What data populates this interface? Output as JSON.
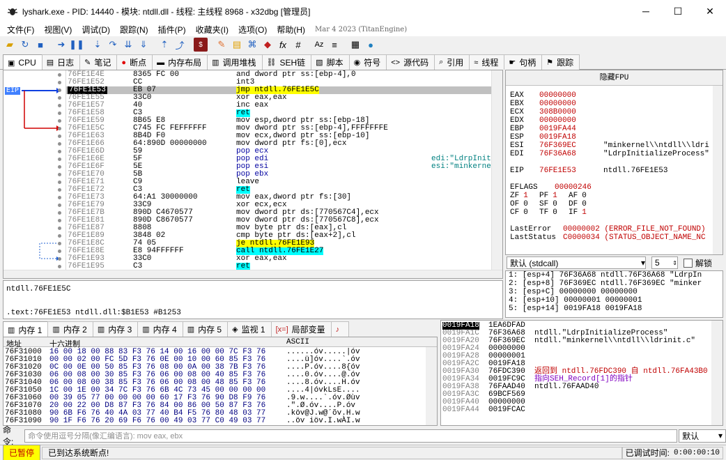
{
  "window": {
    "title": "lyshark.exe - PID: 14440 - 模块: ntdll.dll - 线程: 主线程 8968 - x32dbg [管理员]",
    "app_icon": "bug-icon"
  },
  "menu": {
    "items": [
      "文件(F)",
      "视图(V)",
      "调试(D)",
      "跟踪(N)",
      "插件(P)",
      "收藏夹(I)",
      "选项(O)",
      "帮助(H)"
    ],
    "build_date": "Mar 4 2023 (TitanEngine)"
  },
  "tabs": [
    {
      "label": "CPU",
      "icon": "cpu-icon"
    },
    {
      "label": "日志",
      "icon": "log-icon"
    },
    {
      "label": "笔记",
      "icon": "notes-icon"
    },
    {
      "label": "断点",
      "icon": "breakpoint-icon"
    },
    {
      "label": "内存布局",
      "icon": "memory-map-icon"
    },
    {
      "label": "调用堆栈",
      "icon": "call-stack-icon"
    },
    {
      "label": "SEH链",
      "icon": "seh-icon"
    },
    {
      "label": "脚本",
      "icon": "script-icon"
    },
    {
      "label": "符号",
      "icon": "symbols-icon"
    },
    {
      "label": "源代码",
      "icon": "source-icon"
    },
    {
      "label": "引用",
      "icon": "references-icon"
    },
    {
      "label": "线程",
      "icon": "threads-icon"
    },
    {
      "label": "句柄",
      "icon": "handles-icon"
    },
    {
      "label": "跟踪",
      "icon": "trace-icon"
    }
  ],
  "disasm": {
    "eip_label": "EIP",
    "rows": [
      {
        "addr": "76FE1E4E",
        "bytes": "8365 FC 00",
        "ins": "and dword ptr ss:[ebp-4],0",
        "com": ""
      },
      {
        "addr": "76FE1E52",
        "bytes": "CC",
        "ins": "int3",
        "com": ""
      },
      {
        "addr": "76FE1E53",
        "bytes": "EB 07",
        "ins": "jmp ntdll.76FE1E5C",
        "com": ""
      },
      {
        "addr": "76FE1E55",
        "bytes": "33C0",
        "ins": "xor eax,eax",
        "com": ""
      },
      {
        "addr": "76FE1E57",
        "bytes": "40",
        "ins": "inc eax",
        "com": ""
      },
      {
        "addr": "76FE1E58",
        "bytes": "C3",
        "ins": "ret",
        "com": ""
      },
      {
        "addr": "76FE1E59",
        "bytes": "8B65 E8",
        "ins": "mov esp,dword ptr ss:[ebp-18]",
        "com": ""
      },
      {
        "addr": "76FE1E5C",
        "bytes": "C745 FC FEFFFFFF",
        "ins": "mov dword ptr ss:[ebp-4],FFFFFFFE",
        "com": ""
      },
      {
        "addr": "76FE1E63",
        "bytes": "8B4D F0",
        "ins": "mov ecx,dword ptr ss:[ebp-10]",
        "com": ""
      },
      {
        "addr": "76FE1E66",
        "bytes": "64:890D 00000000",
        "ins": "mov dword ptr fs:[0],ecx",
        "com": ""
      },
      {
        "addr": "76FE1E6D",
        "bytes": "59",
        "ins": "pop ecx",
        "com": ""
      },
      {
        "addr": "76FE1E6E",
        "bytes": "5F",
        "ins": "pop edi",
        "com": "edi:\"LdrpInit"
      },
      {
        "addr": "76FE1E6F",
        "bytes": "5E",
        "ins": "pop esi",
        "com": "esi:\"minkerne"
      },
      {
        "addr": "76FE1E70",
        "bytes": "5B",
        "ins": "pop ebx",
        "com": ""
      },
      {
        "addr": "76FE1E71",
        "bytes": "C9",
        "ins": "leave",
        "com": ""
      },
      {
        "addr": "76FE1E72",
        "bytes": "C3",
        "ins": "ret",
        "com": ""
      },
      {
        "addr": "76FE1E73",
        "bytes": "64:A1 30000000",
        "ins": "mov eax,dword ptr fs:[30]",
        "com": ""
      },
      {
        "addr": "76FE1E79",
        "bytes": "33C9",
        "ins": "xor ecx,ecx",
        "com": ""
      },
      {
        "addr": "76FE1E7B",
        "bytes": "890D C4670577",
        "ins": "mov dword ptr ds:[770567C4],ecx",
        "com": ""
      },
      {
        "addr": "76FE1E81",
        "bytes": "890D C8670577",
        "ins": "mov dword ptr ds:[770567C8],ecx",
        "com": ""
      },
      {
        "addr": "76FE1E87",
        "bytes": "8808",
        "ins": "mov byte ptr ds:[eax],cl",
        "com": ""
      },
      {
        "addr": "76FE1E89",
        "bytes": "3848 02",
        "ins": "cmp byte ptr ds:[eax+2],cl",
        "com": ""
      },
      {
        "addr": "76FE1E8C",
        "bytes": "74 05",
        "ins": "je ntdll.76FE1E93",
        "com": ""
      },
      {
        "addr": "76FE1E8E",
        "bytes": "E8 94FFFFFF",
        "ins": "call ntdll.76FE1E27",
        "com": ""
      },
      {
        "addr": "76FE1E93",
        "bytes": "33C0",
        "ins": "xor eax,eax",
        "com": ""
      },
      {
        "addr": "76FE1E95",
        "bytes": "C3",
        "ins": "ret",
        "com": ""
      }
    ]
  },
  "info": {
    "line1": "ntdll.76FE1E5C",
    "line2": ".text:76FE1E53 ntdll.dll:$B1E53 #B1253"
  },
  "registers": {
    "header": "隐藏FPU",
    "gp": [
      {
        "name": "EAX",
        "val": "00000000",
        "com": ""
      },
      {
        "name": "EBX",
        "val": "00000000",
        "com": ""
      },
      {
        "name": "ECX",
        "val": "308B0000",
        "com": ""
      },
      {
        "name": "EDX",
        "val": "00000000",
        "com": ""
      },
      {
        "name": "EBP",
        "val": "0019FA44",
        "com": ""
      },
      {
        "name": "ESP",
        "val": "0019FA18",
        "com": ""
      },
      {
        "name": "ESI",
        "val": "76F369EC",
        "com": "\"minkernel\\\\ntdll\\\\ldri"
      },
      {
        "name": "EDI",
        "val": "76F36A68",
        "com": "\"LdrpInitializeProcess\""
      }
    ],
    "eip": {
      "name": "EIP",
      "val": "76FE1E53",
      "com": "ntdll.76FE1E53"
    },
    "eflags": {
      "name": "EFLAGS",
      "val": "00000246"
    },
    "flags": [
      [
        "ZF",
        "1",
        "PF",
        "1",
        "AF",
        "0"
      ],
      [
        "OF",
        "0",
        "SF",
        "0",
        "DF",
        "0"
      ],
      [
        "CF",
        "0",
        "TF",
        "0",
        "IF",
        "1"
      ]
    ],
    "last_error": {
      "name": "LastError",
      "val": "00000002 (ERROR_FILE_NOT_FOUND)"
    },
    "last_status": {
      "name": "LastStatus",
      "val": "C0000034 (STATUS_OBJECT_NAME_NC"
    }
  },
  "callconv": {
    "selected": "默认 (stdcall)",
    "count": "5",
    "unlock_label": "解锁"
  },
  "args": [
    "1: [esp+4] 76F36A68 ntdll.76F36A68 \"LdrpIn",
    "2: [esp+8] 76F369EC ntdll.76F369EC \"minker",
    "3: [esp+C] 00000000 00000000",
    "4: [esp+10] 00000001 00000001",
    "5: [esp+14] 0019FA18 0019FA18"
  ],
  "dump_tabs": [
    {
      "label": "内存 1",
      "icon": "memory-icon"
    },
    {
      "label": "内存 2",
      "icon": "memory-icon"
    },
    {
      "label": "内存 3",
      "icon": "memory-icon"
    },
    {
      "label": "内存 4",
      "icon": "memory-icon"
    },
    {
      "label": "内存 5",
      "icon": "memory-icon"
    },
    {
      "label": "监视 1",
      "icon": "watch-icon"
    },
    {
      "label": "局部变量",
      "icon": "locals-icon"
    },
    {
      "label": "",
      "icon": "struct-icon"
    }
  ],
  "dump": {
    "headers": {
      "addr": "地址",
      "hex": "十六进制",
      "ascii": "ASCII"
    },
    "rows": [
      {
        "addr": "76F31000",
        "hex": "16 00 18 00 88 83 F3 76 14 00 16 00 00 7C F3 76",
        "ascii": "......óv.....|óv"
      },
      {
        "addr": "76F31010",
        "hex": "00 00 02 00 FC 5D F3 76 0E 00 10 00 60 85 F3 76",
        "ascii": "....ü]óv....`.óv"
      },
      {
        "addr": "76F31020",
        "hex": "0C 00 0E 00 50 85 F3 76 08 00 0A 00 38 7B F3 76",
        "ascii": "....P.óv....8{óv"
      },
      {
        "addr": "76F31030",
        "hex": "06 00 08 00 30 85 F3 76 06 00 08 00 40 85 F3 76",
        "ascii": "....0.óv....@.óv"
      },
      {
        "addr": "76F31040",
        "hex": "06 00 08 00 38 85 F3 76 06 00 08 00 48 85 F3 76",
        "ascii": "....8.óv....H.óv"
      },
      {
        "addr": "76F31050",
        "hex": "1C 00 1E 00 34 7C F3 76 6B 4C 73 45 00 00 00 00",
        "ascii": "....4|óvkLsE...."
      },
      {
        "addr": "76F31060",
        "hex": "00 39 05 77 00 00 00 00 60 17 F3 76 90 D8 F9 76",
        "ascii": ".9.w....`.óv.Øùv"
      },
      {
        "addr": "76F31070",
        "hex": "20 00 22 00 D8 87 F3 76 84 00 86 00 50 87 F3 76",
        "ascii": " .\".Ø.óv....P.óv"
      },
      {
        "addr": "76F31080",
        "hex": "90 6B F6 76 40 4A 03 77 40 B4 F5 76 80 48 03 77",
        "ascii": ".köv@J.w@´õv.H.w"
      },
      {
        "addr": "76F31090",
        "hex": "90 1F F6 76 20 69 F6 76 00 49 03 77 C0 49 03 77",
        "ascii": "..öv iöv.I.wÀI.w"
      }
    ]
  },
  "stack": {
    "rows": [
      {
        "addr": "0019FA18",
        "val": "1EA6DFAD",
        "com": ""
      },
      {
        "addr": "0019FA1C",
        "val": "76F36A68",
        "com": "ntdll.\"LdrpInitializeProcess\""
      },
      {
        "addr": "0019FA20",
        "val": "76F369EC",
        "com": "ntdll.\"minkernel\\\\ntdll\\\\ldrinit.c\""
      },
      {
        "addr": "0019FA24",
        "val": "00000000",
        "com": ""
      },
      {
        "addr": "0019FA28",
        "val": "00000001",
        "com": ""
      },
      {
        "addr": "0019FA2C",
        "val": "0019FA18",
        "com": ""
      },
      {
        "addr": "0019FA30",
        "val": "76FDC390",
        "com": "返回到 ntdll.76FDC390 自 ntdll.76FA43B0"
      },
      {
        "addr": "0019FA34",
        "val": "0019FC9C",
        "com": "指向SEH_Record[1]的指针"
      },
      {
        "addr": "0019FA38",
        "val": "76FAAD40",
        "com": "ntdll.76FAAD40"
      },
      {
        "addr": "0019FA3C",
        "val": "69BCF569",
        "com": ""
      },
      {
        "addr": "0019FA40",
        "val": "00000000",
        "com": ""
      },
      {
        "addr": "0019FA44",
        "val": "0019FCAC",
        "com": ""
      }
    ]
  },
  "command": {
    "label": "命令:",
    "placeholder": "命令使用逗号分隔(像汇编语言): mov eax, ebx",
    "mode": "默认"
  },
  "status": {
    "state": "已暂停",
    "message": "已到达系统断点!",
    "time_label": "已调试时间:",
    "time_value": "0:00:00:10"
  },
  "colors": {
    "accent": "#0078d7",
    "paused_bg": "#ffff00",
    "paused_fg": "#c00000"
  }
}
